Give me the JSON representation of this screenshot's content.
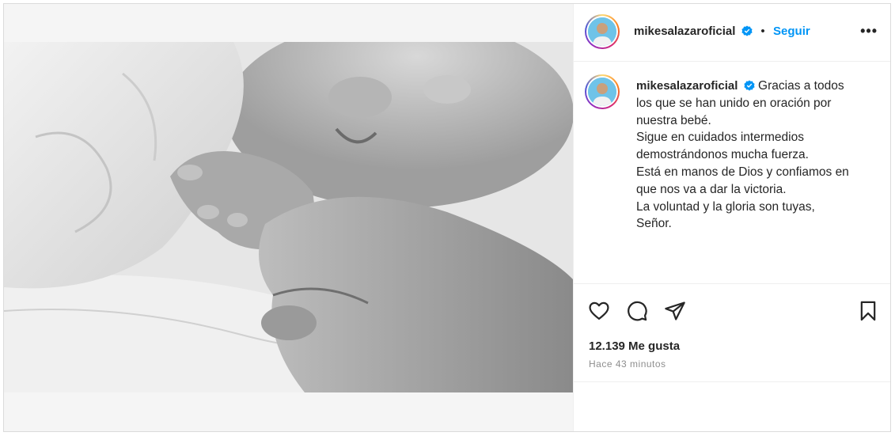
{
  "post": {
    "author": {
      "username": "mikesalazaroficial",
      "verified": true,
      "follow_label": "Seguir",
      "separator": "•"
    },
    "more_label": "•••",
    "caption": {
      "username": "mikesalazaroficial",
      "lines": [
        "Gracias a todos",
        "los que se han unido en oración por",
        "nuestra bebé.",
        "Sigue en cuidados intermedios",
        "demostrándonos mucha fuerza.",
        "Está en manos de Dios y confiamos en",
        "que nos va a dar la victoria.",
        "La voluntad y la gloria son tuyas,",
        "Señor."
      ]
    },
    "likes": "12.139 Me gusta",
    "timestamp": "Hace 43 minutos",
    "icons": [
      "heart-icon",
      "comment-icon",
      "share-icon",
      "bookmark-icon",
      "user-tag-icon",
      "verified-badge-icon"
    ],
    "colors": {
      "follow": "#0095f6",
      "verified": "#0095f6",
      "text": "#262626",
      "muted": "#8e8e8e"
    }
  }
}
